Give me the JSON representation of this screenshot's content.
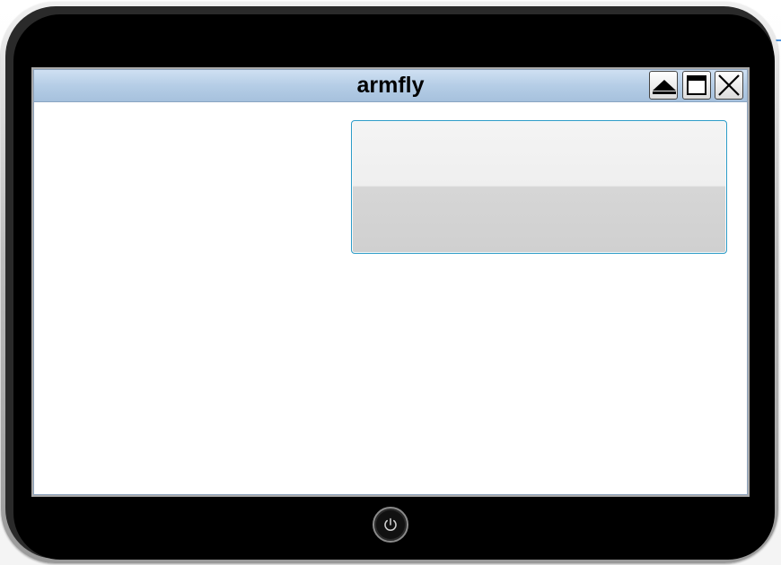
{
  "window": {
    "title": "armfly"
  },
  "icons": {
    "minimize": "triangle-up-icon",
    "maximize": "window-maximize-icon",
    "close": "close-icon",
    "power": "power-icon"
  },
  "colors": {
    "titlebar": "#b5cde6",
    "button_border": "#2d9cc8",
    "bezel": "#000000"
  }
}
